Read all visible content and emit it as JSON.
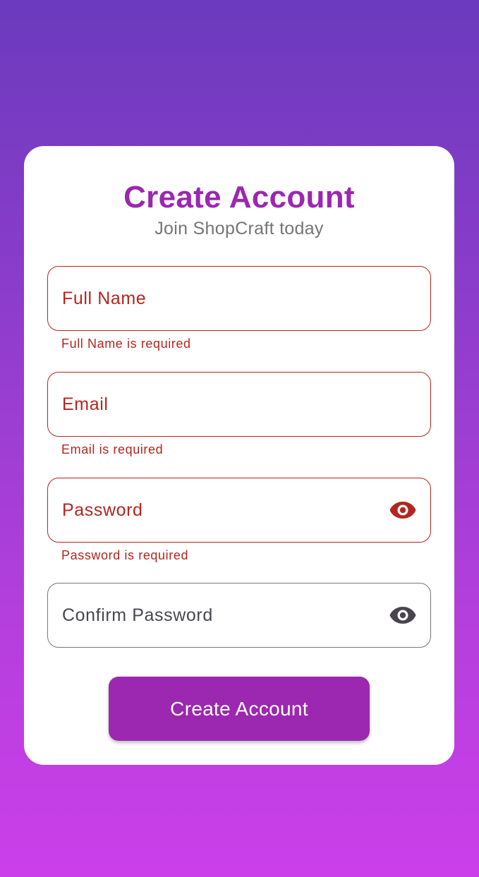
{
  "header": {
    "title": "Create Account",
    "subtitle": "Join ShopCraft today"
  },
  "form": {
    "full_name": {
      "placeholder": "Full Name",
      "error": "Full Name is required"
    },
    "email": {
      "placeholder": "Email",
      "error": "Email is required"
    },
    "password": {
      "placeholder": "Password",
      "error": "Password is required",
      "toggle_icon": "eye-icon"
    },
    "confirm_password": {
      "placeholder": "Confirm Password",
      "toggle_icon": "eye-icon"
    },
    "submit_label": "Create Account"
  },
  "colors": {
    "accent": "#9c27b0",
    "error": "#b3261e",
    "muted": "#757575",
    "gradient_top": "#6b3abd",
    "gradient_bottom": "#cb3fea"
  }
}
